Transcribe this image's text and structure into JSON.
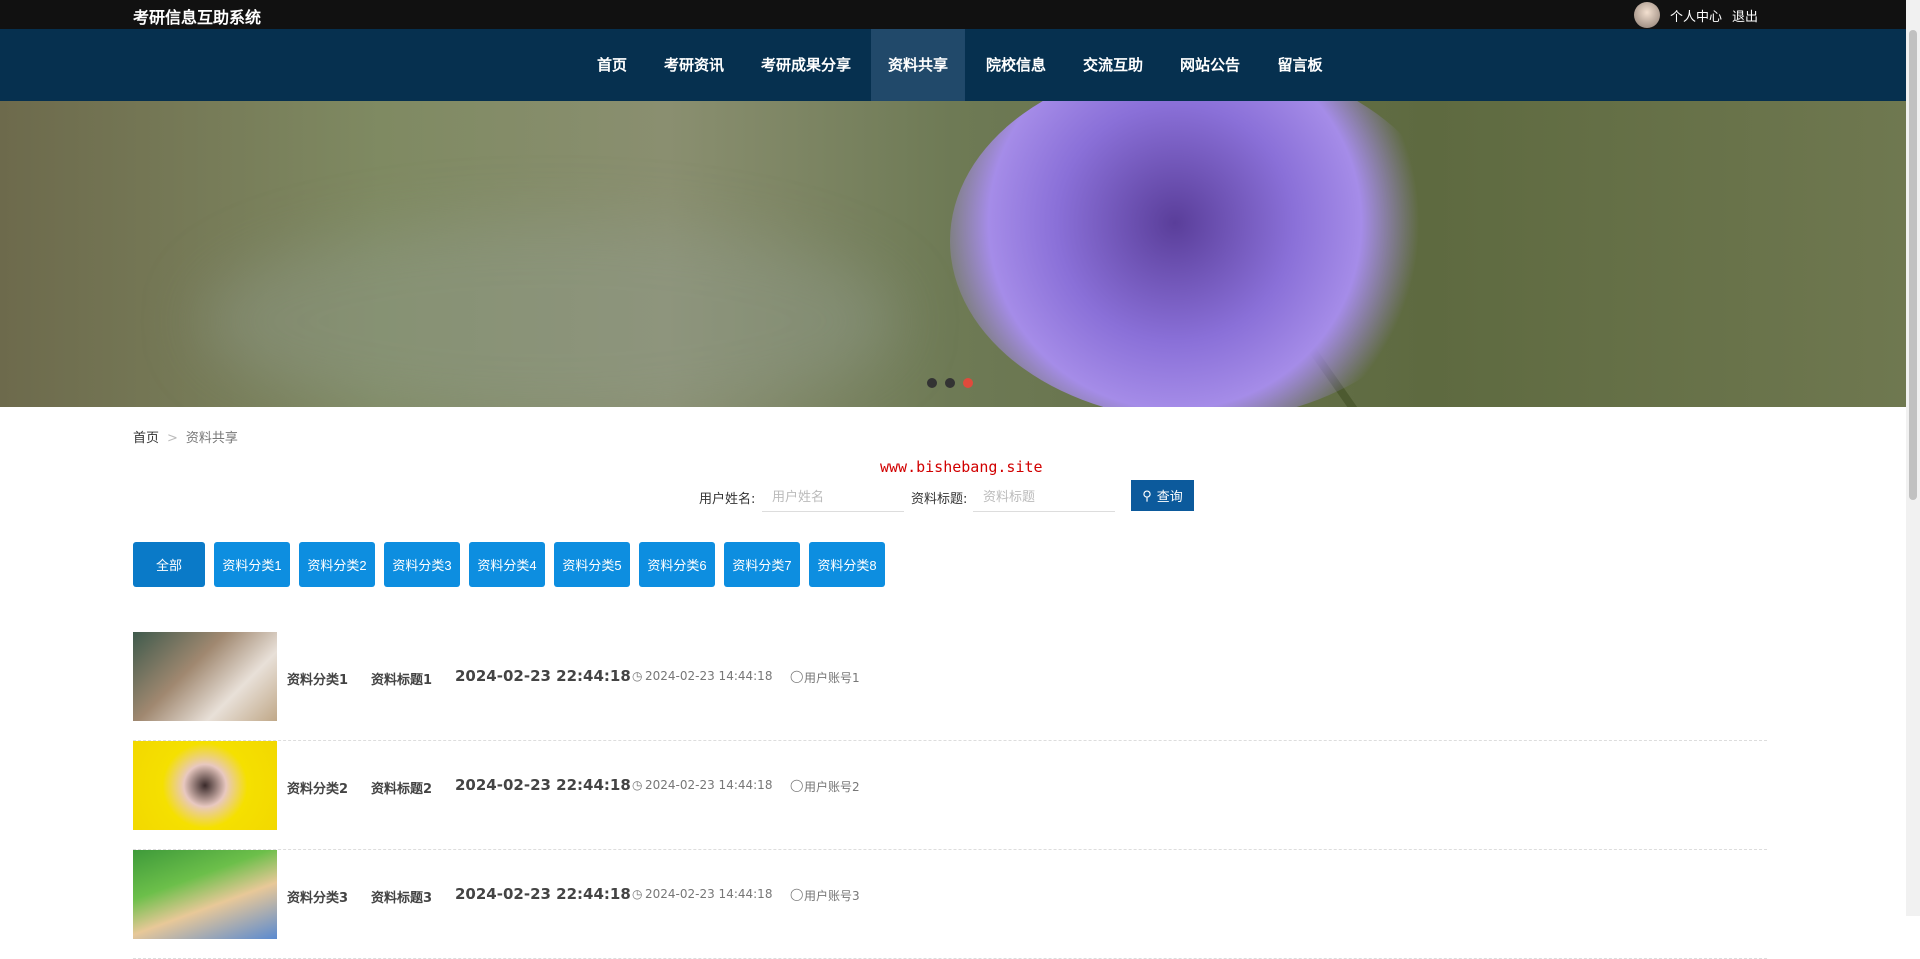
{
  "header": {
    "title": "考研信息互助系统",
    "user_center": "个人中心",
    "logout": "退出"
  },
  "nav": [
    {
      "label": "首页"
    },
    {
      "label": "考研资讯"
    },
    {
      "label": "考研成果分享"
    },
    {
      "label": "资料共享",
      "active": true
    },
    {
      "label": "院校信息"
    },
    {
      "label": "交流互助"
    },
    {
      "label": "网站公告"
    },
    {
      "label": "留言板"
    }
  ],
  "banner": {
    "slides": 3,
    "active_slide": 3
  },
  "breadcrumb": {
    "home": "首页",
    "sep": ">",
    "current": "资料共享"
  },
  "watermark": "www.bishebang.site",
  "search": {
    "name_label": "用户姓名:",
    "name_placeholder": "用户姓名",
    "title_label": "资料标题:",
    "title_placeholder": "资料标题",
    "button": "查询"
  },
  "categories": [
    "全部",
    "资料分类1",
    "资料分类2",
    "资料分类3",
    "资料分类4",
    "资料分类5",
    "资料分类6",
    "资料分类7",
    "资料分类8"
  ],
  "items": [
    {
      "category": "资料分类1",
      "title": "资料标题1",
      "date": "2024-02-23 22:44:18",
      "time": "2024-02-23 14:44:18",
      "account": "用户账号1"
    },
    {
      "category": "资料分类2",
      "title": "资料标题2",
      "date": "2024-02-23 22:44:18",
      "time": "2024-02-23 14:44:18",
      "account": "用户账号2"
    },
    {
      "category": "资料分类3",
      "title": "资料标题3",
      "date": "2024-02-23 22:44:18",
      "time": "2024-02-23 14:44:18",
      "account": "用户账号3"
    }
  ],
  "colors": {
    "nav": "#06304f",
    "button": "#0d8ee0",
    "query": "#0c5a9c"
  }
}
